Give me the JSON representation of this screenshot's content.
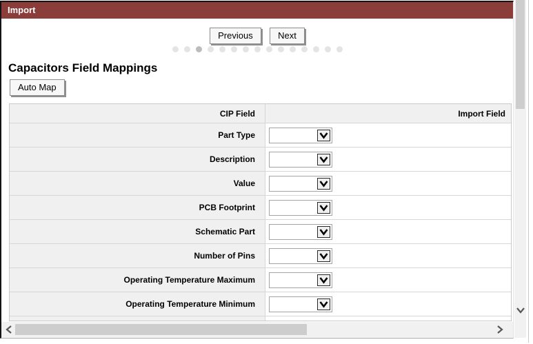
{
  "window": {
    "title": "Import"
  },
  "nav": {
    "previous_label": "Previous",
    "next_label": "Next"
  },
  "steps": {
    "count": 15,
    "active_index": 2
  },
  "section": {
    "heading": "Capacitors Field Mappings",
    "automap_label": "Auto Map"
  },
  "table": {
    "headers": {
      "cip_field": "CIP Field",
      "import_field": "Import Field"
    },
    "rows": [
      {
        "label": "Part Type",
        "selected_value": ""
      },
      {
        "label": "Description",
        "selected_value": ""
      },
      {
        "label": "Value",
        "selected_value": ""
      },
      {
        "label": "PCB Footprint",
        "selected_value": ""
      },
      {
        "label": "Schematic Part",
        "selected_value": ""
      },
      {
        "label": "Number of Pins",
        "selected_value": ""
      },
      {
        "label": "Operating Temperature Maximum",
        "selected_value": ""
      },
      {
        "label": "Operating Temperature Minimum",
        "selected_value": ""
      },
      {
        "label": "",
        "selected_value": ""
      }
    ]
  },
  "icons": {
    "select_arrow": "chevron-down-icon",
    "scroll_left": "chevron-left-icon",
    "scroll_right": "chevron-right-icon",
    "scroll_down": "chevron-down-icon"
  },
  "colors": {
    "titlebar_bg": "#8b3d3a",
    "titlebar_text": "#ffffff",
    "row_label_bg": "#f0f0f0",
    "table_border": "#d6d6d6",
    "scrollbar_track": "#f1f1f1",
    "scrollbar_thumb": "#cdcdcd",
    "dot_inactive": "#e4e4e4",
    "dot_active": "#bcbcbc"
  }
}
